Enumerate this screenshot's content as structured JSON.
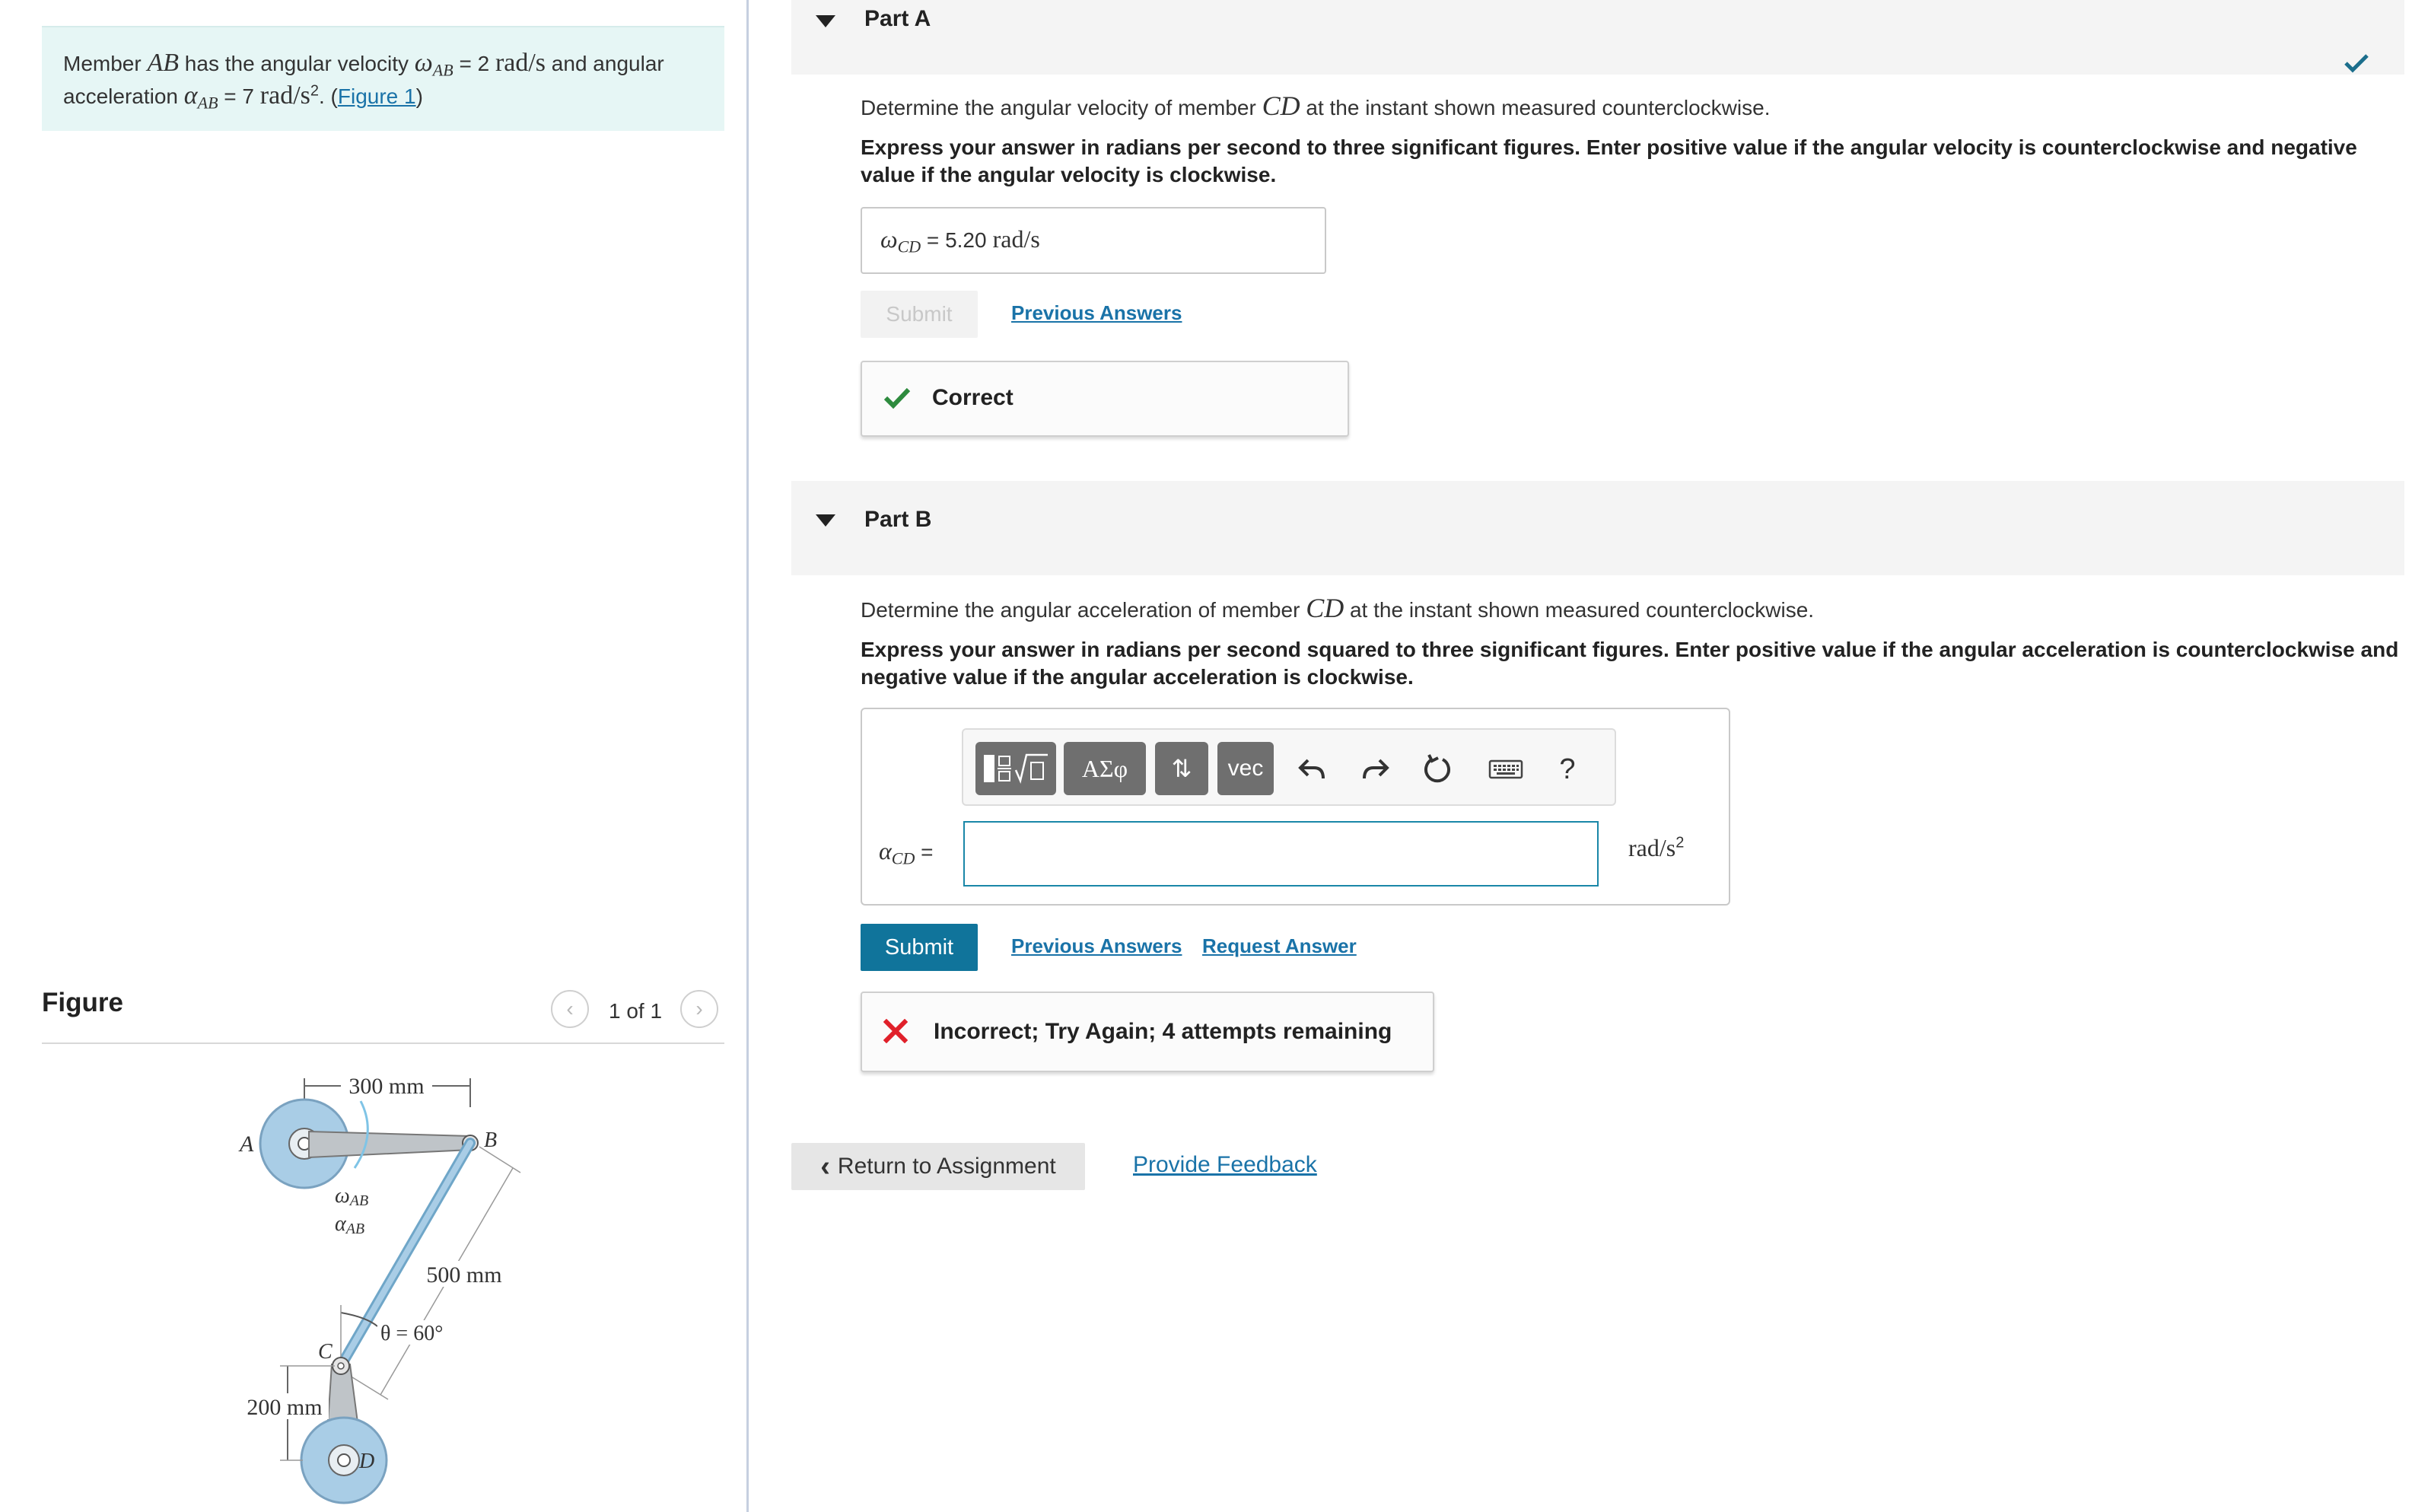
{
  "problem": {
    "intro": "Member ",
    "member": "AB",
    "mid1": " has the angular velocity ",
    "omega_symbol": "ω",
    "omega_sub": "AB",
    "eq1": " = 2 ",
    "unit1": "rad/s",
    "mid2": " and angular acceleration ",
    "alpha_symbol": "α",
    "alpha_sub": "AB",
    "eq2": " = 7 ",
    "unit2_base": "rad/s",
    "unit2_exp": "2",
    "tail": ". (",
    "figure_link": "Figure 1",
    "close": ")"
  },
  "figure_panel": {
    "heading": "Figure",
    "pager_label": "1 of 1",
    "labels": {
      "dim_ab": "300 mm",
      "dim_bc": "500 mm",
      "dim_cd": "200 mm",
      "point_a": "A",
      "point_b": "B",
      "point_c": "C",
      "point_d": "D",
      "omega_label": "ω",
      "alpha_label": "α",
      "ab_sub": "AB",
      "theta_label": "θ = 60°"
    }
  },
  "partA": {
    "title": "Part A",
    "q_pre": "Determine the angular velocity of member ",
    "q_member": "CD",
    "q_post": " at the instant shown measured counterclockwise.",
    "instructions": "Express your answer in radians per second to three significant figures. Enter positive value if the angular velocity is counterclockwise and negative value if the angular velocity is clockwise.",
    "var_symbol": "ω",
    "var_sub": "CD",
    "equals": " = ",
    "answer_value": "5.20",
    "answer_unit": "rad/s",
    "submit_label": "Submit",
    "previous_answers": "Previous Answers",
    "feedback": "Correct"
  },
  "partB": {
    "title": "Part B",
    "q_pre": "Determine the angular acceleration of member ",
    "q_member": "CD",
    "q_post": " at the instant shown measured counterclockwise.",
    "instructions": "Express your answer in radians per second squared to three significant figures. Enter positive value if the angular acceleration is counterclockwise and negative value if the angular acceleration is clockwise.",
    "var_symbol": "α",
    "var_sub": "CD",
    "equals": " = ",
    "input_value": "",
    "unit_base": "rad/s",
    "unit_exp": "2",
    "toolbar": {
      "greek_label": "ΑΣφ",
      "sort_label": "⇅",
      "vec_label": "vec",
      "help_label": "?"
    },
    "submit_label": "Submit",
    "previous_answers": "Previous Answers",
    "request_answer": "Request Answer",
    "feedback": "Incorrect; Try Again; 4 attempts remaining"
  },
  "footer": {
    "return_label": "Return to Assignment",
    "feedback_link": "Provide Feedback"
  },
  "colors": {
    "accent": "#10749b",
    "link": "#1a73a8",
    "correct": "#2e8b3e",
    "incorrect": "#e0202a",
    "problem_bg": "#e6f6f5"
  }
}
